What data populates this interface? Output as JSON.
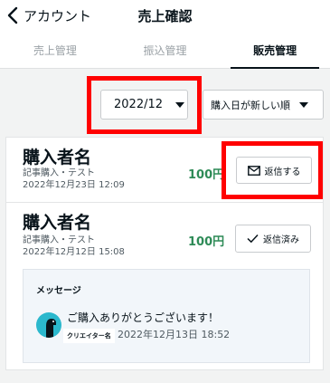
{
  "header": {
    "back_label": "アカウント",
    "title": "売上確認"
  },
  "tabs": [
    {
      "label": "売上管理",
      "active": false
    },
    {
      "label": "振込管理",
      "active": false
    },
    {
      "label": "販売管理",
      "active": true
    }
  ],
  "filters": {
    "month": "2022/12",
    "sort": "購入日が新しい順"
  },
  "orders": [
    {
      "buyer": "購入者名",
      "item": "記事購入・テスト",
      "date": "2022年12月23日 12:09",
      "price": "100円",
      "action_label": "返信する",
      "action_icon": "mail-icon"
    },
    {
      "buyer": "購入者名",
      "item": "記事購入・テスト",
      "date": "2022年12月12日 15:08",
      "price": "100円",
      "action_label": "返信済み",
      "action_icon": "check-icon"
    }
  ],
  "message": {
    "heading": "メッセージ",
    "text": "ご購入ありがとうございます！",
    "creator": "クリエイター名",
    "date": "2022年12月13日 18:52"
  },
  "colors": {
    "highlight": "#ff0000",
    "price": "#2e8b57",
    "avatar": "#2bb8cd"
  }
}
